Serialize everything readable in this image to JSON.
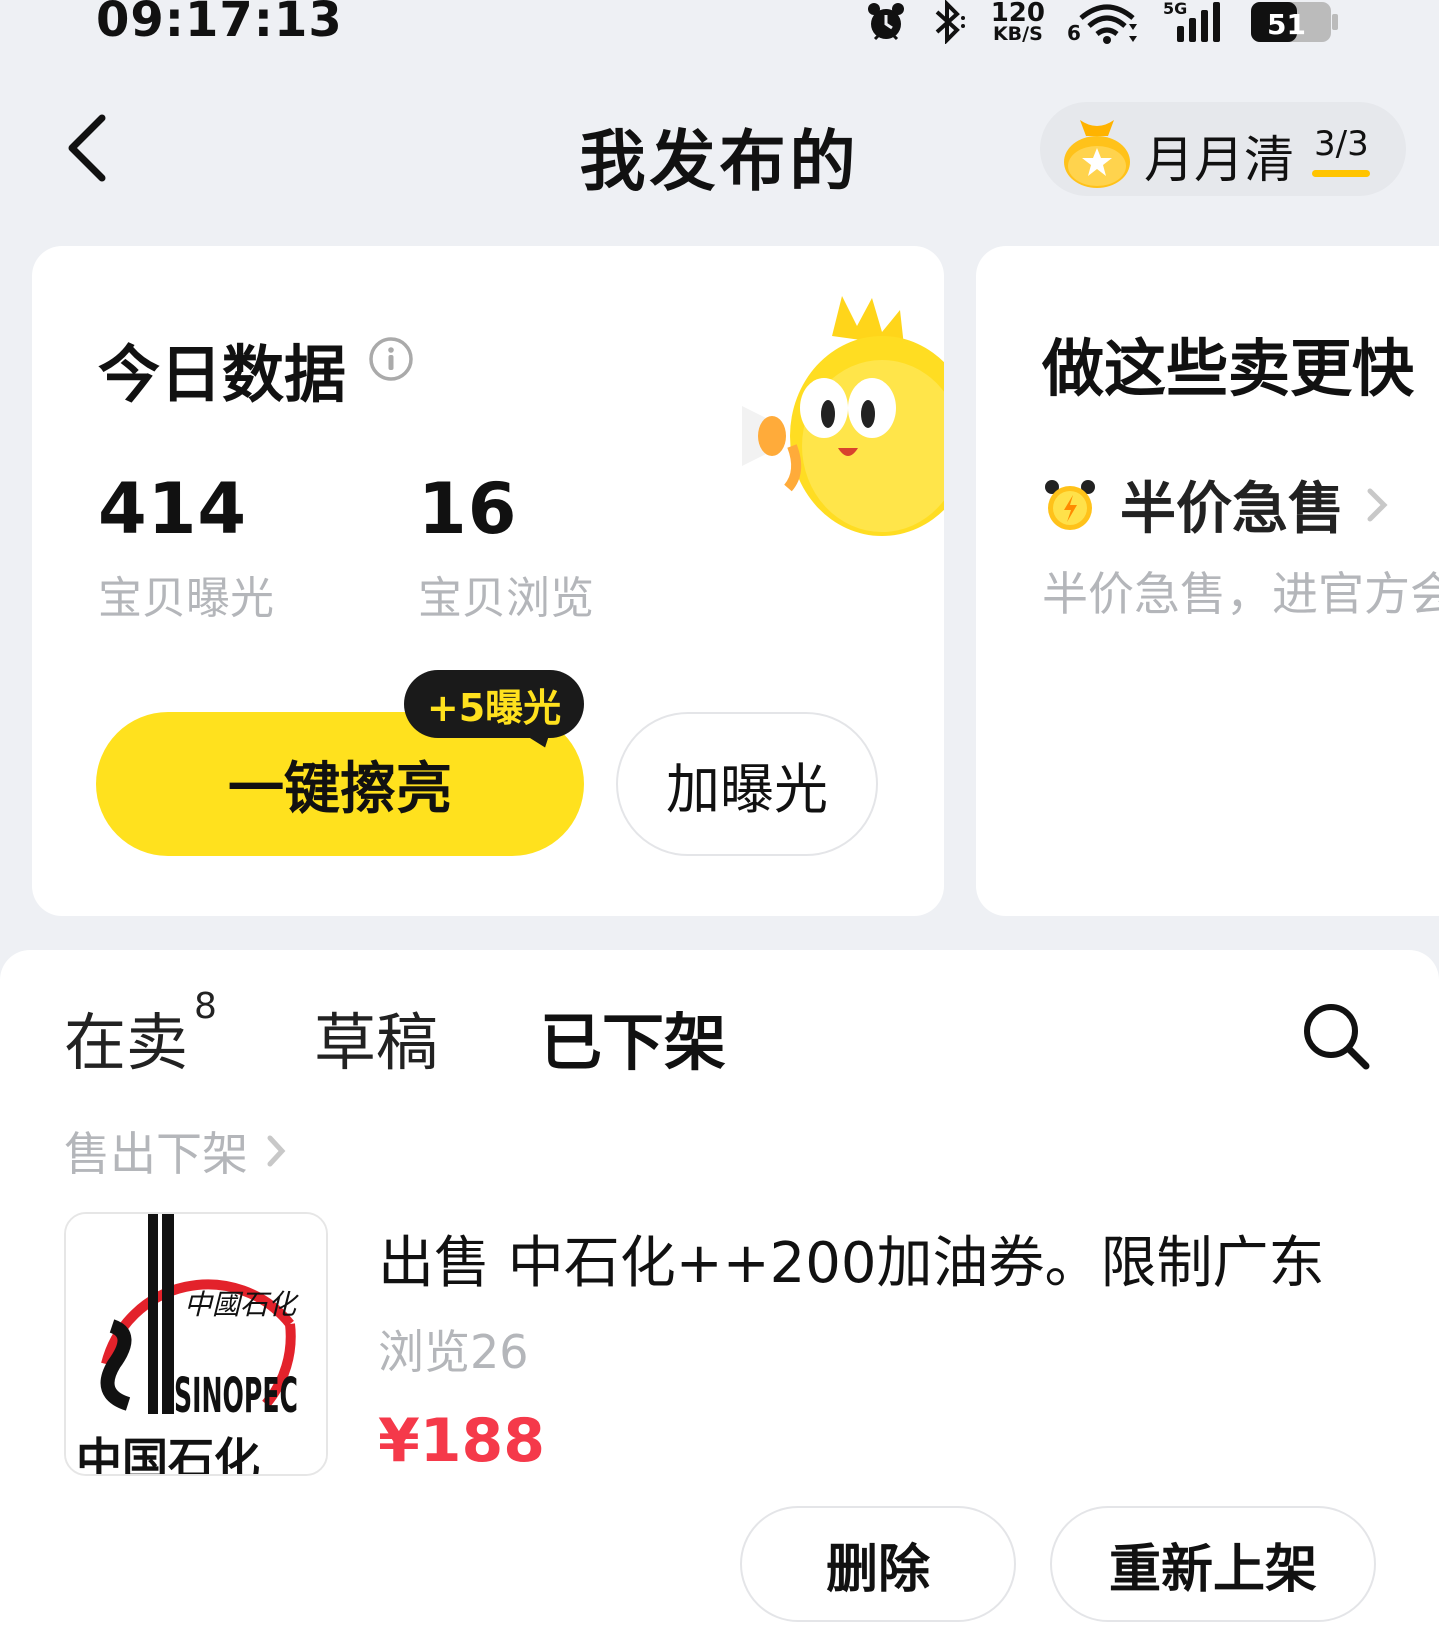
{
  "status_bar": {
    "time": "09:17:13",
    "net_speed_value": "120",
    "net_speed_unit": "KB/S",
    "network_type": "5G",
    "wifi_index": "6",
    "battery_level": "51",
    "icons": [
      "alarm-icon",
      "bluetooth-icon",
      "wifi-icon",
      "signal-icon",
      "battery-icon"
    ]
  },
  "header": {
    "title": "我发布的",
    "back_icon": "chevron-left-icon",
    "monthly_label": "月月清",
    "monthly_count": "3/3"
  },
  "today_data": {
    "title": "今日数据",
    "stats": [
      {
        "value": "414",
        "label": "宝贝曝光"
      },
      {
        "value": "16",
        "label": "宝贝浏览"
      }
    ],
    "polish_button": "一键擦亮",
    "bonus_tag": "+5曝光",
    "exposure_button": "加曝光"
  },
  "tips": {
    "title": "做这些卖更快",
    "half_price_label": "半价急售",
    "half_price_desc": "半价急售，进官方会"
  },
  "listing": {
    "tabs": [
      {
        "label": "在卖",
        "count": "8"
      },
      {
        "label": "草稿"
      },
      {
        "label": "已下架",
        "active": true
      }
    ],
    "filter_label": "售出下架",
    "items": [
      {
        "title": "出售 中石化++200加油券。限制广东",
        "views": "浏览26",
        "price": "¥188",
        "thumb_text_cn": "中國石化",
        "thumb_logo_text": "SINOPEC",
        "thumb_bottom_text": "中国石化"
      }
    ],
    "delete_button": "删除",
    "relist_button": "重新上架"
  },
  "colors": {
    "accent_yellow": "#ffe11e",
    "price_red": "#f5394a",
    "background": "#eef0f4"
  }
}
